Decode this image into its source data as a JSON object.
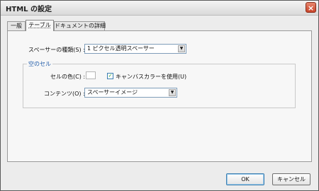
{
  "window": {
    "title": "HTML の設定",
    "close_glyph": "×"
  },
  "tabs": [
    {
      "label": "一般",
      "active": false
    },
    {
      "label": "テーブル",
      "active": true
    },
    {
      "label": "ドキュメントの詳細",
      "active": false
    }
  ],
  "spacer": {
    "label": "スペーサーの種類(S) :",
    "selected": "1 ピクセル透明スペーサー"
  },
  "empty_cell": {
    "group_title": "空のセル",
    "cell_color_label": "セルの色(C) :",
    "cell_color": "#ffffff",
    "canvas_checkbox_label": "キャンバスカラーを使用(U)",
    "canvas_checkbox_checked": true,
    "content_label": "コンテンツ(O) :",
    "content_selected": "スペーサーイメージ"
  },
  "buttons": {
    "ok": "OK",
    "cancel": "キャンセル"
  },
  "icons": {
    "close": "close-icon",
    "dropdown": "chevron-down-icon",
    "check": "checkmark-icon"
  }
}
